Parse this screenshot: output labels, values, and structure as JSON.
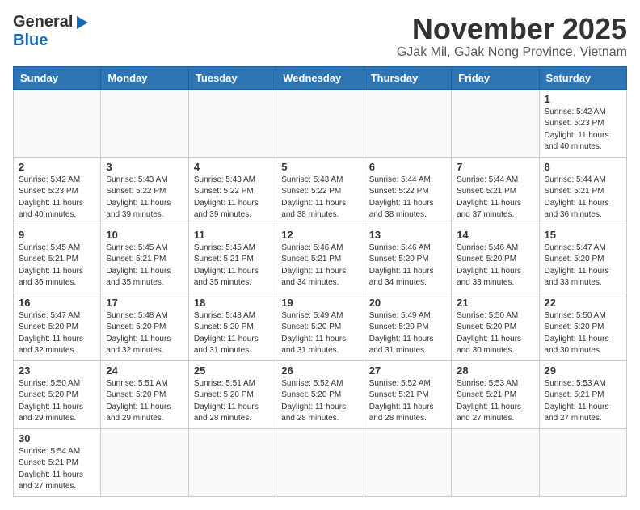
{
  "header": {
    "logo_general": "General",
    "logo_blue": "Blue",
    "month_title": "November 2025",
    "location": "GJak Mil, GJak Nong Province, Vietnam"
  },
  "weekdays": [
    "Sunday",
    "Monday",
    "Tuesday",
    "Wednesday",
    "Thursday",
    "Friday",
    "Saturday"
  ],
  "days": [
    {
      "date": "",
      "sunrise": "",
      "sunset": "",
      "daylight": "",
      "empty": true
    },
    {
      "date": "",
      "sunrise": "",
      "sunset": "",
      "daylight": "",
      "empty": true
    },
    {
      "date": "",
      "sunrise": "",
      "sunset": "",
      "daylight": "",
      "empty": true
    },
    {
      "date": "",
      "sunrise": "",
      "sunset": "",
      "daylight": "",
      "empty": true
    },
    {
      "date": "",
      "sunrise": "",
      "sunset": "",
      "daylight": "",
      "empty": true
    },
    {
      "date": "",
      "sunrise": "",
      "sunset": "",
      "daylight": "",
      "empty": true
    },
    {
      "date": "1",
      "sunrise": "Sunrise: 5:42 AM",
      "sunset": "Sunset: 5:23 PM",
      "daylight": "Daylight: 11 hours and 40 minutes.",
      "empty": false
    },
    {
      "date": "2",
      "sunrise": "Sunrise: 5:42 AM",
      "sunset": "Sunset: 5:23 PM",
      "daylight": "Daylight: 11 hours and 40 minutes.",
      "empty": false
    },
    {
      "date": "3",
      "sunrise": "Sunrise: 5:43 AM",
      "sunset": "Sunset: 5:22 PM",
      "daylight": "Daylight: 11 hours and 39 minutes.",
      "empty": false
    },
    {
      "date": "4",
      "sunrise": "Sunrise: 5:43 AM",
      "sunset": "Sunset: 5:22 PM",
      "daylight": "Daylight: 11 hours and 39 minutes.",
      "empty": false
    },
    {
      "date": "5",
      "sunrise": "Sunrise: 5:43 AM",
      "sunset": "Sunset: 5:22 PM",
      "daylight": "Daylight: 11 hours and 38 minutes.",
      "empty": false
    },
    {
      "date": "6",
      "sunrise": "Sunrise: 5:44 AM",
      "sunset": "Sunset: 5:22 PM",
      "daylight": "Daylight: 11 hours and 38 minutes.",
      "empty": false
    },
    {
      "date": "7",
      "sunrise": "Sunrise: 5:44 AM",
      "sunset": "Sunset: 5:21 PM",
      "daylight": "Daylight: 11 hours and 37 minutes.",
      "empty": false
    },
    {
      "date": "8",
      "sunrise": "Sunrise: 5:44 AM",
      "sunset": "Sunset: 5:21 PM",
      "daylight": "Daylight: 11 hours and 36 minutes.",
      "empty": false
    },
    {
      "date": "9",
      "sunrise": "Sunrise: 5:45 AM",
      "sunset": "Sunset: 5:21 PM",
      "daylight": "Daylight: 11 hours and 36 minutes.",
      "empty": false
    },
    {
      "date": "10",
      "sunrise": "Sunrise: 5:45 AM",
      "sunset": "Sunset: 5:21 PM",
      "daylight": "Daylight: 11 hours and 35 minutes.",
      "empty": false
    },
    {
      "date": "11",
      "sunrise": "Sunrise: 5:45 AM",
      "sunset": "Sunset: 5:21 PM",
      "daylight": "Daylight: 11 hours and 35 minutes.",
      "empty": false
    },
    {
      "date": "12",
      "sunrise": "Sunrise: 5:46 AM",
      "sunset": "Sunset: 5:21 PM",
      "daylight": "Daylight: 11 hours and 34 minutes.",
      "empty": false
    },
    {
      "date": "13",
      "sunrise": "Sunrise: 5:46 AM",
      "sunset": "Sunset: 5:20 PM",
      "daylight": "Daylight: 11 hours and 34 minutes.",
      "empty": false
    },
    {
      "date": "14",
      "sunrise": "Sunrise: 5:46 AM",
      "sunset": "Sunset: 5:20 PM",
      "daylight": "Daylight: 11 hours and 33 minutes.",
      "empty": false
    },
    {
      "date": "15",
      "sunrise": "Sunrise: 5:47 AM",
      "sunset": "Sunset: 5:20 PM",
      "daylight": "Daylight: 11 hours and 33 minutes.",
      "empty": false
    },
    {
      "date": "16",
      "sunrise": "Sunrise: 5:47 AM",
      "sunset": "Sunset: 5:20 PM",
      "daylight": "Daylight: 11 hours and 32 minutes.",
      "empty": false
    },
    {
      "date": "17",
      "sunrise": "Sunrise: 5:48 AM",
      "sunset": "Sunset: 5:20 PM",
      "daylight": "Daylight: 11 hours and 32 minutes.",
      "empty": false
    },
    {
      "date": "18",
      "sunrise": "Sunrise: 5:48 AM",
      "sunset": "Sunset: 5:20 PM",
      "daylight": "Daylight: 11 hours and 31 minutes.",
      "empty": false
    },
    {
      "date": "19",
      "sunrise": "Sunrise: 5:49 AM",
      "sunset": "Sunset: 5:20 PM",
      "daylight": "Daylight: 11 hours and 31 minutes.",
      "empty": false
    },
    {
      "date": "20",
      "sunrise": "Sunrise: 5:49 AM",
      "sunset": "Sunset: 5:20 PM",
      "daylight": "Daylight: 11 hours and 31 minutes.",
      "empty": false
    },
    {
      "date": "21",
      "sunrise": "Sunrise: 5:50 AM",
      "sunset": "Sunset: 5:20 PM",
      "daylight": "Daylight: 11 hours and 30 minutes.",
      "empty": false
    },
    {
      "date": "22",
      "sunrise": "Sunrise: 5:50 AM",
      "sunset": "Sunset: 5:20 PM",
      "daylight": "Daylight: 11 hours and 30 minutes.",
      "empty": false
    },
    {
      "date": "23",
      "sunrise": "Sunrise: 5:50 AM",
      "sunset": "Sunset: 5:20 PM",
      "daylight": "Daylight: 11 hours and 29 minutes.",
      "empty": false
    },
    {
      "date": "24",
      "sunrise": "Sunrise: 5:51 AM",
      "sunset": "Sunset: 5:20 PM",
      "daylight": "Daylight: 11 hours and 29 minutes.",
      "empty": false
    },
    {
      "date": "25",
      "sunrise": "Sunrise: 5:51 AM",
      "sunset": "Sunset: 5:20 PM",
      "daylight": "Daylight: 11 hours and 28 minutes.",
      "empty": false
    },
    {
      "date": "26",
      "sunrise": "Sunrise: 5:52 AM",
      "sunset": "Sunset: 5:20 PM",
      "daylight": "Daylight: 11 hours and 28 minutes.",
      "empty": false
    },
    {
      "date": "27",
      "sunrise": "Sunrise: 5:52 AM",
      "sunset": "Sunset: 5:21 PM",
      "daylight": "Daylight: 11 hours and 28 minutes.",
      "empty": false
    },
    {
      "date": "28",
      "sunrise": "Sunrise: 5:53 AM",
      "sunset": "Sunset: 5:21 PM",
      "daylight": "Daylight: 11 hours and 27 minutes.",
      "empty": false
    },
    {
      "date": "29",
      "sunrise": "Sunrise: 5:53 AM",
      "sunset": "Sunset: 5:21 PM",
      "daylight": "Daylight: 11 hours and 27 minutes.",
      "empty": false
    },
    {
      "date": "30",
      "sunrise": "Sunrise: 5:54 AM",
      "sunset": "Sunset: 5:21 PM",
      "daylight": "Daylight: 11 hours and 27 minutes.",
      "empty": false
    },
    {
      "date": "",
      "sunrise": "",
      "sunset": "",
      "daylight": "",
      "empty": true
    },
    {
      "date": "",
      "sunrise": "",
      "sunset": "",
      "daylight": "",
      "empty": true
    },
    {
      "date": "",
      "sunrise": "",
      "sunset": "",
      "daylight": "",
      "empty": true
    },
    {
      "date": "",
      "sunrise": "",
      "sunset": "",
      "daylight": "",
      "empty": true
    },
    {
      "date": "",
      "sunrise": "",
      "sunset": "",
      "daylight": "",
      "empty": true
    },
    {
      "date": "",
      "sunrise": "",
      "sunset": "",
      "daylight": "",
      "empty": true
    }
  ]
}
